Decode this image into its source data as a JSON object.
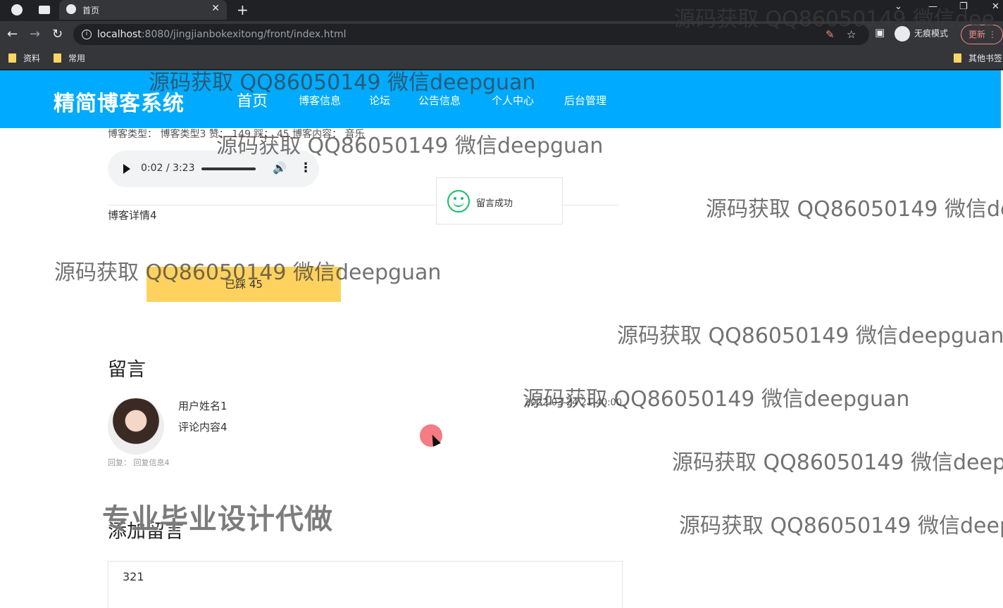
{
  "browser": {
    "tab_title": "首页",
    "url_host": "localhost",
    "url_rest": ":8080/jingjianbokexitong/front/index.html",
    "incognito_label": "无痕模式",
    "update_label": "更新",
    "bookmarks": [
      "资料",
      "常用"
    ],
    "other_bookmarks": "其他书签"
  },
  "site": {
    "logo": "精简博客系统",
    "nav": [
      "首页",
      "博客信息",
      "论坛",
      "公告信息",
      "个人中心",
      "后台管理"
    ]
  },
  "blog": {
    "meta_line": "博客类型：  博客类型3   赞：  149   踩：  45   博客内容：  音乐",
    "audio_time": "0:02 / 3:23",
    "audio_progress": 0.01,
    "detail": "博客详情4",
    "stomp_button": "已踩   45"
  },
  "toast": {
    "message": "留言成功"
  },
  "comments": {
    "title": "留言",
    "items": [
      {
        "user": "用户姓名1",
        "content": "评论内容4",
        "time": "2022-03-24 21:40:00",
        "reply": "回复：  回复信息4"
      }
    ]
  },
  "add_comment": {
    "title": "添加留言",
    "textarea_value": "321"
  },
  "watermarks": {
    "main": "源码获取 QQ86050149 微信deepguan",
    "cut1": "源码获取 QQ86050149 微信dee",
    "cut2": "源码获取 QQ86050149 微信de",
    "cut3": "源码获取 QQ86050149 微信deepg",
    "cut4": "源码获取 QQ86050149 微信deep",
    "strong": "专业毕业设计代做"
  }
}
